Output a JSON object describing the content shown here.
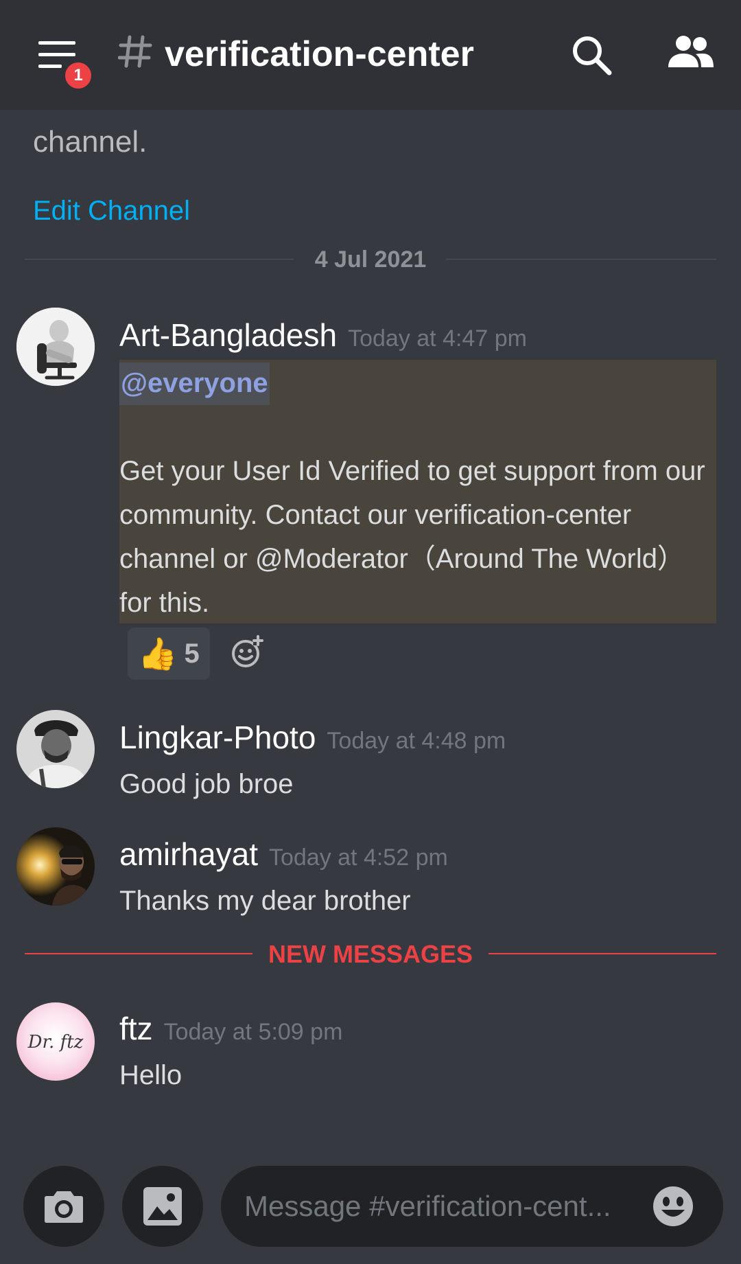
{
  "header": {
    "menu_badge": "1",
    "hash": "#",
    "channel_name": "verification-center"
  },
  "intro": {
    "description_tail": "channel.",
    "edit_channel_label": "Edit Channel"
  },
  "date_divider": "4 Jul 2021",
  "messages": [
    {
      "username": "Art-Bangladesh",
      "timestamp": "Today at 4:47 pm",
      "mention": "@everyone",
      "body": "Get your User Id Verified to get support from our community. Contact our verification-center channel or @Moderator（Around The World）for this.",
      "reaction": {
        "emoji": "👍",
        "count": "5"
      }
    },
    {
      "username": "Lingkar-Photo",
      "timestamp": "Today at 4:48 pm",
      "body": "Good job broe"
    },
    {
      "username": "amirhayat",
      "timestamp": "Today at 4:52 pm",
      "body": "Thanks my dear brother"
    },
    {
      "username": "ftz",
      "timestamp": "Today at 5:09 pm",
      "body": "Hello",
      "avatar_text": "Dr. ftz"
    }
  ],
  "new_messages_label": "NEW MESSAGES",
  "composer": {
    "placeholder": "Message #verification-cent..."
  },
  "icons": {
    "menu": "hamburger-menu-icon",
    "search": "search-icon",
    "members": "members-icon",
    "add_reaction": "add-reaction-icon",
    "camera": "camera-icon",
    "gallery": "image-icon",
    "emoji": "emoji-icon"
  },
  "colors": {
    "background": "#36393f",
    "header": "#2f3136",
    "link": "#00aff4",
    "mention_text": "#8ea1e1",
    "mention_highlight": "#49443c",
    "new_messages": "#ed4245"
  }
}
